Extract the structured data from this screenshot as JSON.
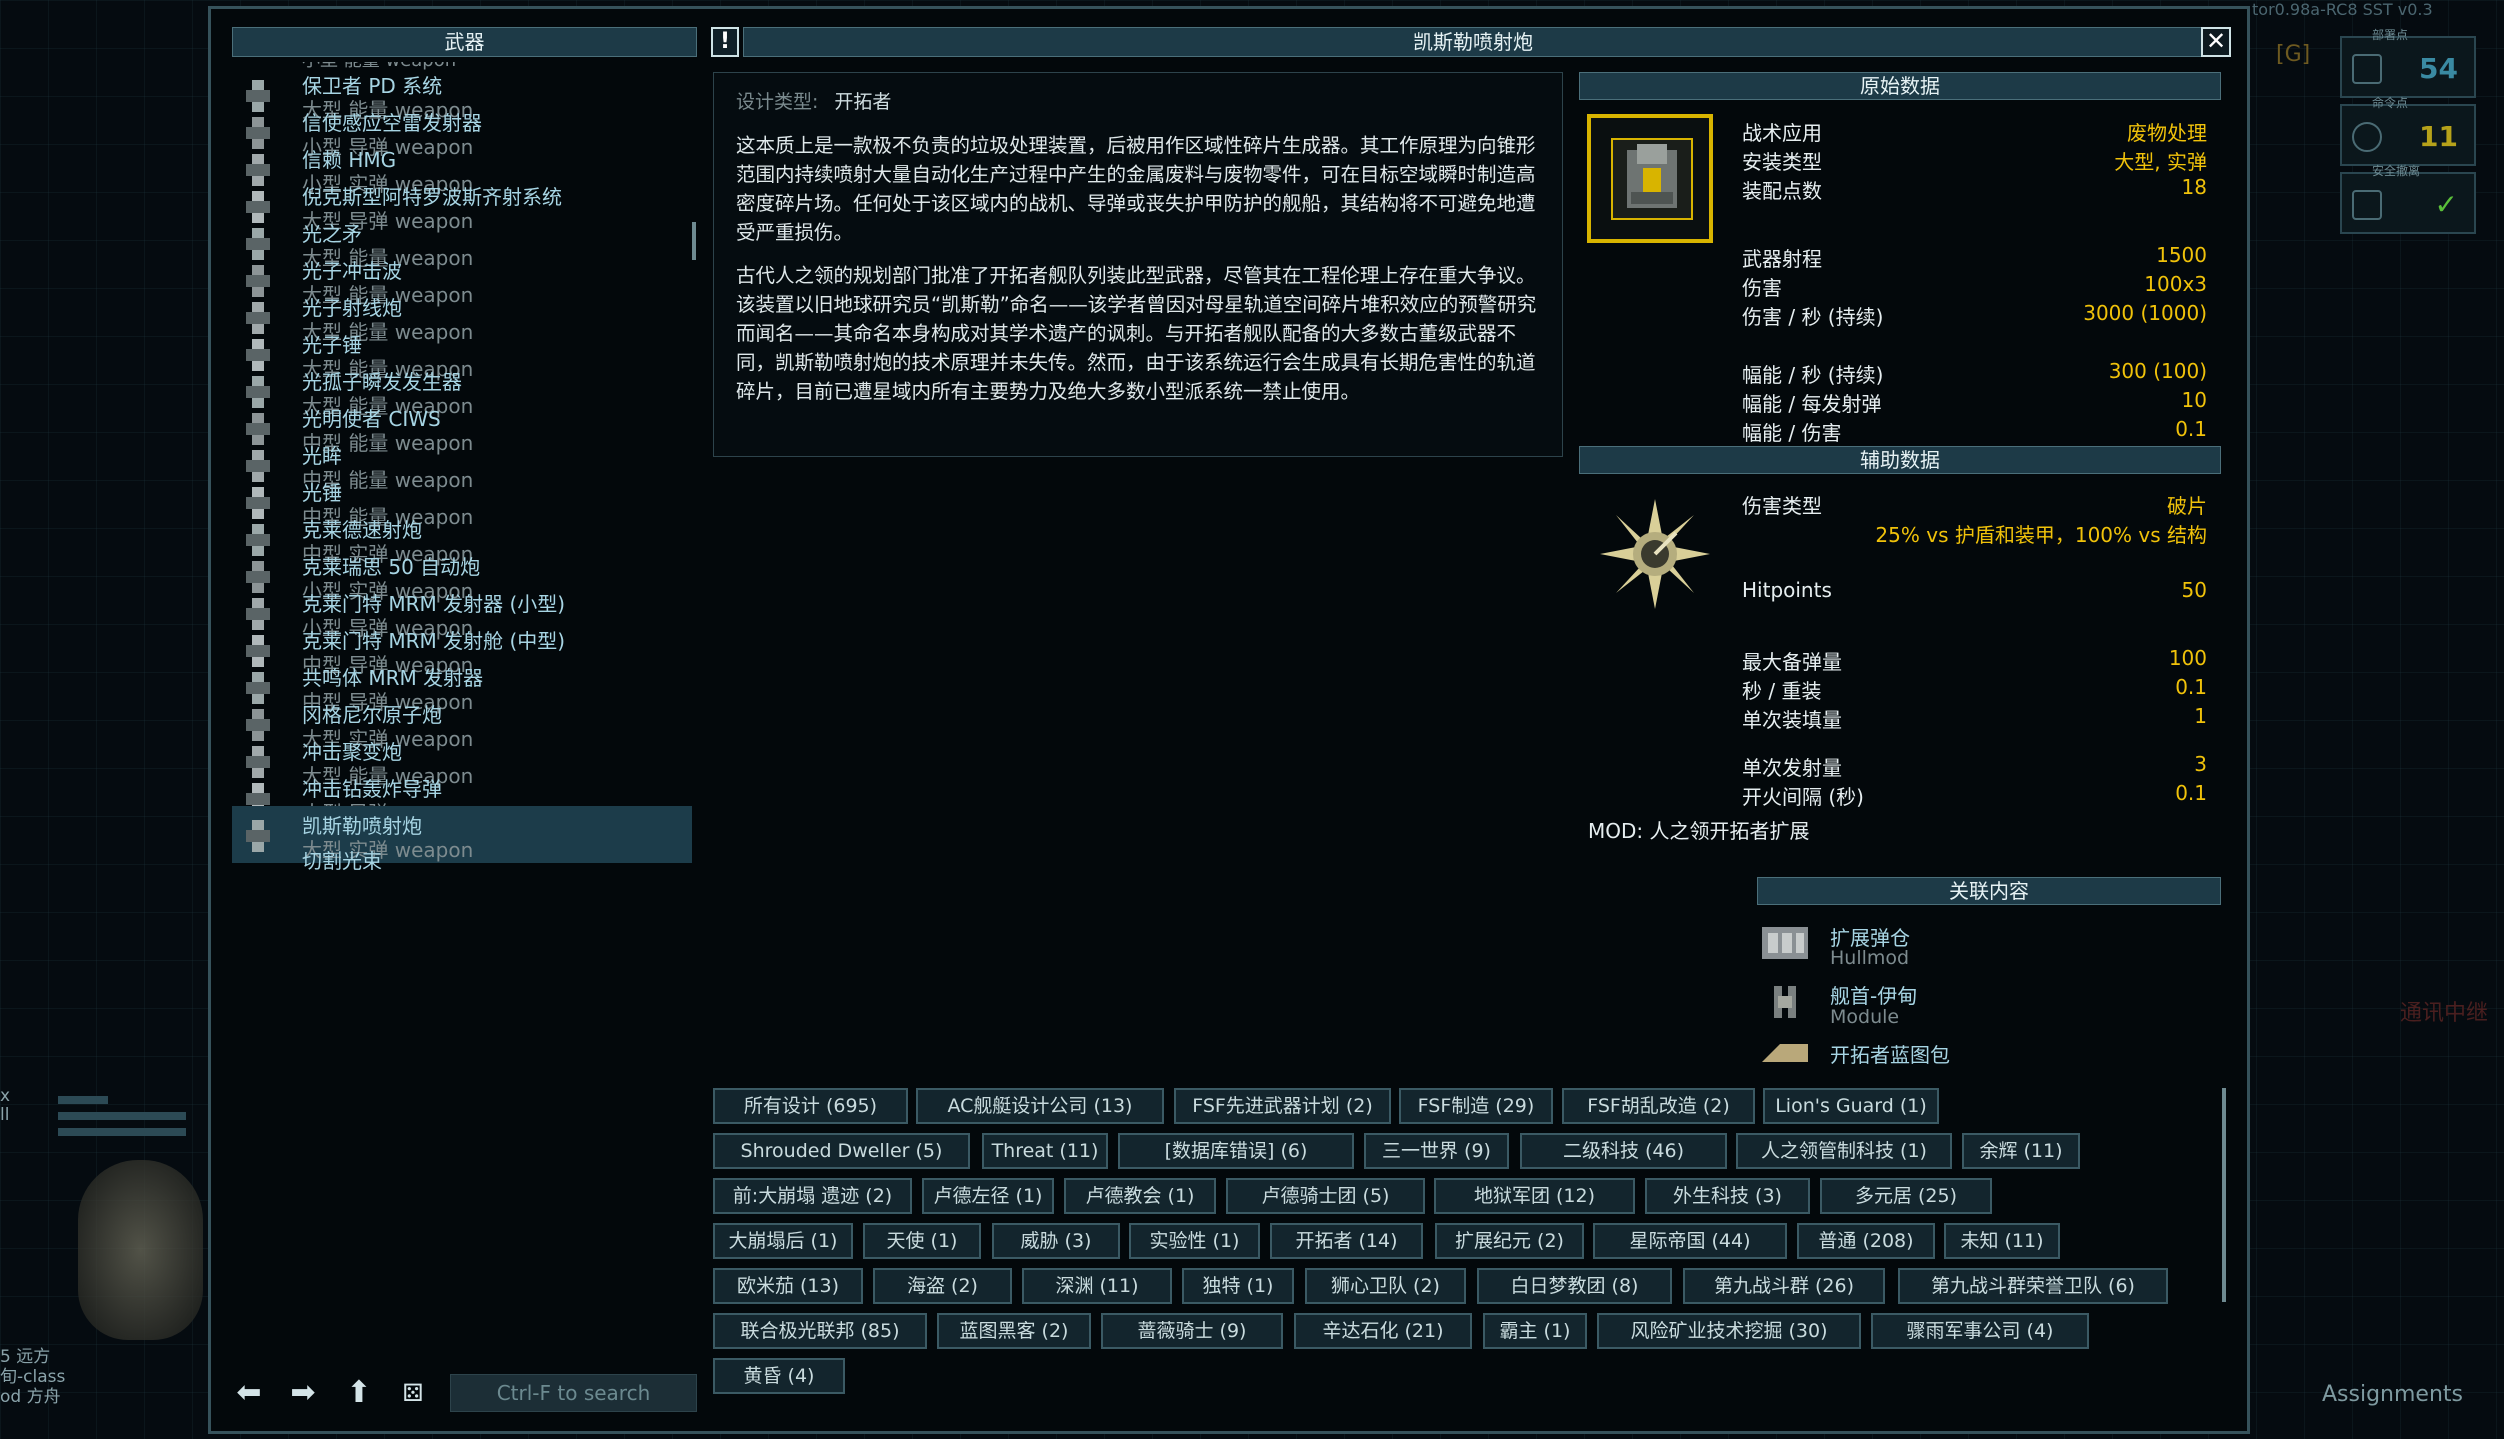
{
  "colors": {
    "accent_yellow": "#f0c20a",
    "header_bg": "#1d3a47",
    "name_blue": "#a7d5e4",
    "selected_bg": "#1c3c4a"
  },
  "background": {
    "left": {
      "lines": [
        "x",
        "ll",
        "5 远方",
        "旬-class",
        "od 方舟"
      ]
    },
    "right": {
      "top_label": "tor0.98a-RC8 SST v0.3",
      "box1_label": "部署点",
      "box1_value": "54",
      "box2_label": "命令点",
      "box2_value": "11",
      "box3_label": "安全撤离",
      "g_label": "[G]",
      "comm_label": "通讯中继",
      "assignments": "Assignments"
    }
  },
  "list_panel": {
    "header": "武器",
    "top_partial": "小型 能量 weapon",
    "items": [
      {
        "name": "保卫者 PD 系统",
        "sub": "大型 能量 weapon"
      },
      {
        "name": "信使感应空雷发射器",
        "sub": "小型 导弹 weapon"
      },
      {
        "name": "信赖 HMG",
        "sub": "小型 实弹 weapon"
      },
      {
        "name": "倪克斯型阿特罗波斯齐射系统",
        "sub": "大型 导弹 weapon"
      },
      {
        "name": "光之矛",
        "sub": "大型 能量 weapon"
      },
      {
        "name": "光子冲击波",
        "sub": "大型 能量 weapon"
      },
      {
        "name": "光子射线炮",
        "sub": "大型 能量 weapon"
      },
      {
        "name": "光子锤",
        "sub": "大型 能量 weapon"
      },
      {
        "name": "光孤子瞬发发生器",
        "sub": "大型 能量 weapon"
      },
      {
        "name": "光明使者 CIWS",
        "sub": "中型 能量 weapon"
      },
      {
        "name": "光眸",
        "sub": "中型 能量 weapon"
      },
      {
        "name": "光锤",
        "sub": "中型 能量 weapon"
      },
      {
        "name": "克莱德速射炮",
        "sub": "中型 实弹 weapon"
      },
      {
        "name": "克莱瑞思 50 自动炮",
        "sub": "小型 实弹 weapon"
      },
      {
        "name": "克莱门特 MRM 发射器 (小型)",
        "sub": "小型 导弹 weapon"
      },
      {
        "name": "克莱门特 MRM 发射舱 (中型)",
        "sub": "中型 导弹 weapon"
      },
      {
        "name": "共鸣体 MRM 发射器",
        "sub": "中型 导弹 weapon"
      },
      {
        "name": "冈格尼尔原子炮",
        "sub": "大型 实弹 weapon"
      },
      {
        "name": "冲击聚变炮",
        "sub": "大型 能量 weapon"
      },
      {
        "name": "冲击钻轰炸导弹",
        "sub": "大型 导弹 weapon"
      },
      {
        "name": "凯斯勒喷射炮",
        "sub": "大型 实弹 weapon"
      }
    ],
    "bottom_partial": "切割光束",
    "search_placeholder": "Ctrl-F to search"
  },
  "detail": {
    "title": "凯斯勒喷射炮",
    "warn_symbol": "!",
    "close_symbol": "✕",
    "design_type_label": "设计类型:",
    "design_type_value": "开拓者",
    "para1": "这本质上是一款极不负责的垃圾处理装置，后被用作区域性碎片生成器。其工作原理为向锥形范围内持续喷射大量自动化生产过程中产生的金属废料与废物零件，可在目标空域瞬时制造高密度碎片场。任何处于该区域内的战机、导弹或丧失护甲防护的舰船，其结构将不可避免地遭受严重损伤。",
    "para2": "古代人之领的规划部门批准了开拓者舰队列装此型武器，尽管其在工程伦理上存在重大争议。该装置以旧地球研究员“凯斯勒”命名——该学者曾因对母星轨道空间碎片堆积效应的预警研究而闻名——其命名本身构成对其学术遗产的讽刺。与开拓者舰队配备的大多数古董级武器不同，凯斯勒喷射炮的技术原理并未失传。然而，由于该系统运行会生成具有长期危害性的轨道碎片，目前已遭星域内所有主要势力及绝大多数小型派系统一禁止使用。",
    "raw_header": "原始数据",
    "raw_stats": [
      {
        "label": "战术应用",
        "value": "废物处理"
      },
      {
        "label": "安装类型",
        "value": "大型, 实弹"
      },
      {
        "label": "装配点数",
        "value": "18"
      },
      {
        "label": "武器射程",
        "value": "1500"
      },
      {
        "label": "伤害",
        "value": "100x3"
      },
      {
        "label": "伤害 / 秒 (持续)",
        "value": "3000 (1000)"
      },
      {
        "label": "幅能 / 秒 (持续)",
        "value": "300 (100)"
      },
      {
        "label": "幅能 / 每发射弹",
        "value": "10"
      },
      {
        "label": "幅能 / 伤害",
        "value": "0.1"
      }
    ],
    "aux_header": "辅助数据",
    "aux_stats": [
      {
        "label": "伤害类型",
        "value": "破片"
      },
      {
        "label": "",
        "value": "25% vs 护盾和装甲，100% vs 结构"
      },
      {
        "label": "Hitpoints",
        "value": "50"
      },
      {
        "label": "最大备弹量",
        "value": "100"
      },
      {
        "label": "秒 / 重装",
        "value": "0.1"
      },
      {
        "label": "单次装填量",
        "value": "1"
      },
      {
        "label": "单次发射量",
        "value": "3"
      },
      {
        "label": "开火间隔 (秒)",
        "value": "0.1"
      }
    ],
    "mod_line": "MOD: 人之领开拓者扩展",
    "related_header": "关联内容",
    "related": [
      {
        "name": "扩展弹仓",
        "sub": "Hullmod"
      },
      {
        "name": "舰首-伊甸",
        "sub": "Module"
      },
      {
        "name": "开拓者蓝图包",
        "sub": ""
      }
    ]
  },
  "tags": [
    "所有设计 (695)",
    "AC舰艇设计公司 (13)",
    "FSF先进武器计划 (2)",
    "FSF制造 (29)",
    "FSF胡乱改造 (2)",
    "Lion's Guard (1)",
    "Shrouded Dweller (5)",
    "Threat (11)",
    "[数据库错误] (6)",
    "三一世界 (9)",
    "二级科技 (46)",
    "人之领管制科技 (1)",
    "余辉 (11)",
    "前:大崩塌 遗迹 (2)",
    "卢德左径 (1)",
    "卢德教会 (1)",
    "卢德骑士团 (5)",
    "地狱军团 (12)",
    "外生科技 (3)",
    "多元居 (25)",
    "大崩塌后 (1)",
    "天使 (1)",
    "威胁 (3)",
    "实验性 (1)",
    "开拓者 (14)",
    "扩展纪元 (2)",
    "星际帝国 (44)",
    "普通 (208)",
    "未知 (11)",
    "欧米茄 (13)",
    "海盗 (2)",
    "深渊 (11)",
    "独特 (1)",
    "狮心卫队 (2)",
    "白日梦教团 (8)",
    "第九战斗群 (26)",
    "第九战斗群荣誉卫队 (6)",
    "联合极光联邦 (85)",
    "蓝图黑客 (2)",
    "蔷薇骑士 (9)",
    "辛达石化 (21)",
    "霸主 (1)",
    "风险矿业技术挖掘 (30)",
    "骤雨军事公司 (4)",
    "黄昏 (4)"
  ]
}
